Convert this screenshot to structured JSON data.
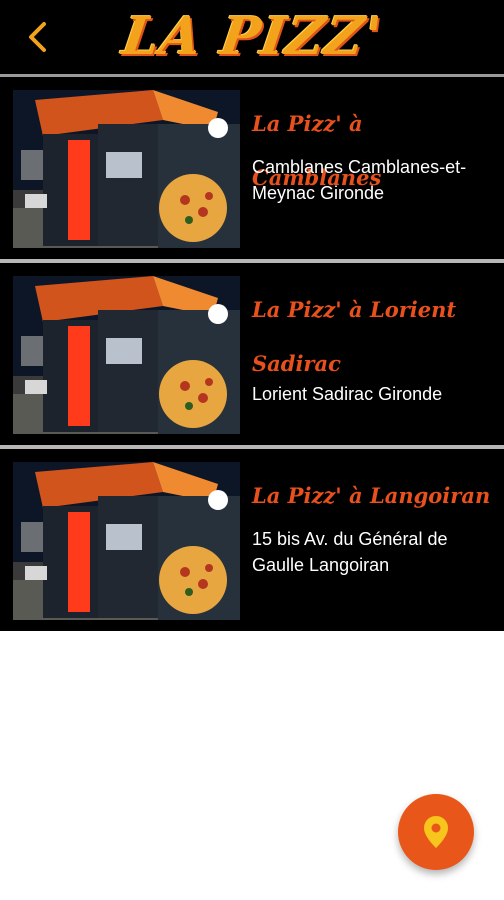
{
  "header": {
    "logo_text": "LA PIZZ'",
    "back_icon": "chevron-left-icon"
  },
  "locations": [
    {
      "title": "La Pizz' à Camblanes",
      "address": "Camblanes Camblanes-et-Meynac Gironde"
    },
    {
      "title": "La Pizz' à Lorient Sadirac",
      "address": "Lorient Sadirac Gironde"
    },
    {
      "title": "La Pizz' à Langoiran",
      "address": "15 bis Av. du Général de Gaulle Langoiran"
    }
  ],
  "fab": {
    "icon": "map-pin-icon"
  },
  "colors": {
    "accent": "#e8561a",
    "logo": "#f3a21c",
    "back": "#f3a21c",
    "pin": "#f7c51b",
    "header_bg": "#000000"
  }
}
